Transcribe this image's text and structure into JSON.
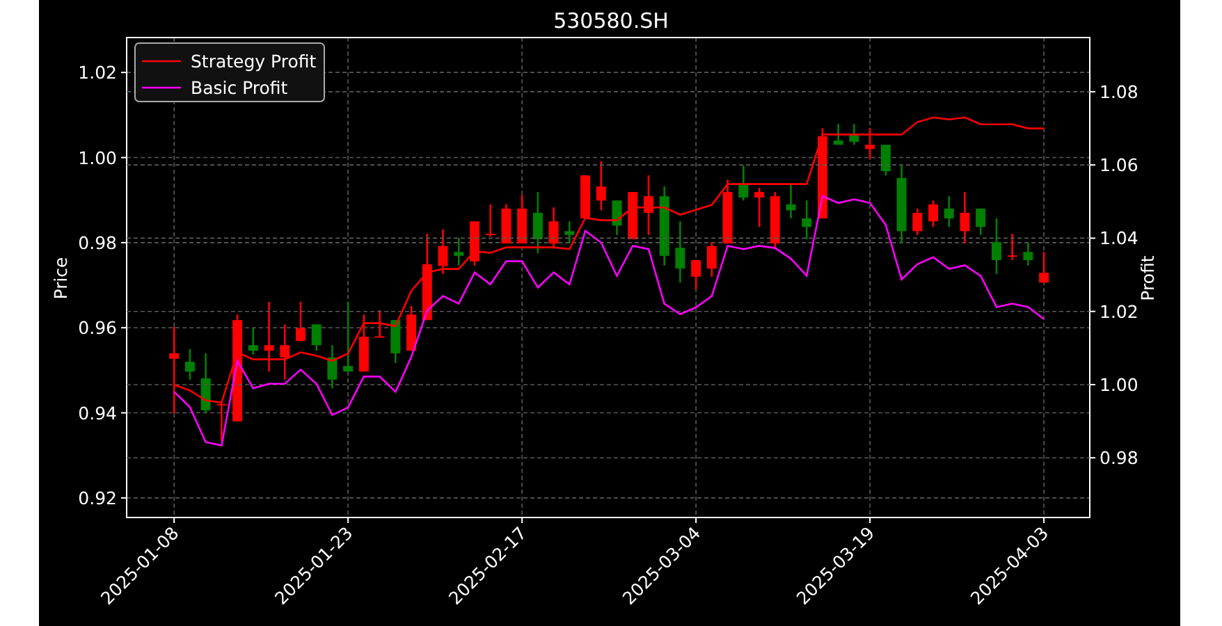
{
  "charts": [
    {
      "chart_data": {
        "type": "candlestick",
        "title": "530580.SH",
        "ylabel": "Price",
        "grid": true,
        "categories": [
          "2025-01-08",
          null,
          null,
          null,
          null,
          null,
          null,
          null,
          null,
          null,
          null,
          "2025-01-23",
          null,
          null,
          null,
          null,
          null,
          null,
          null,
          null,
          null,
          null,
          "2025-02-17",
          null,
          null,
          null,
          null,
          null,
          null,
          null,
          null,
          null,
          null,
          "2025-03-04",
          null,
          null,
          null,
          null,
          null,
          null,
          null,
          null,
          null,
          null,
          "2025-03-19",
          null,
          null,
          null,
          null,
          null,
          null,
          null,
          null,
          null,
          null,
          "2025-04-03"
        ],
        "ylim": [
          0.9154,
          1.0282
        ],
        "yticks": [
          {
            "value": 0.92,
            "label": "0.92"
          },
          {
            "value": 0.94,
            "label": "0.94"
          },
          {
            "value": 0.96,
            "label": "0.96"
          },
          {
            "value": 0.98,
            "label": "0.98"
          },
          {
            "value": 1.0,
            "label": "1.00"
          },
          {
            "value": 1.02,
            "label": "1.02"
          }
        ],
        "ohlc": [
          [
            0.9527,
            0.9602,
            0.9399,
            0.954
          ],
          [
            0.952,
            0.955,
            0.9478,
            0.9497
          ],
          [
            0.9481,
            0.954,
            0.9399,
            0.9406
          ],
          [
            0.9418,
            0.9422,
            0.9334,
            0.9421
          ],
          [
            0.938,
            0.9631,
            0.938,
            0.9618
          ],
          [
            0.9559,
            0.9599,
            0.9537,
            0.9546
          ],
          [
            0.9546,
            0.9661,
            0.9497,
            0.9559
          ],
          [
            0.953,
            0.9608,
            0.9478,
            0.9559
          ],
          [
            0.9569,
            0.9661,
            0.9569,
            0.9599
          ],
          [
            0.9608,
            0.9608,
            0.9546,
            0.9559
          ],
          [
            0.953,
            0.9559,
            0.9458,
            0.9478
          ],
          [
            0.951,
            0.9661,
            0.9497,
            0.9497
          ],
          [
            0.9497,
            0.9631,
            0.9497,
            0.9579
          ],
          [
            0.9578,
            0.9641,
            0.9578,
            0.958
          ],
          [
            0.9618,
            0.9618,
            0.9517,
            0.954
          ],
          [
            0.9546,
            0.9651,
            0.9546,
            0.9631
          ],
          [
            0.9618,
            0.9821,
            0.9618,
            0.9749
          ],
          [
            0.9745,
            0.9831,
            0.9726,
            0.9792
          ],
          [
            0.9778,
            0.9811,
            0.9746,
            0.9769
          ],
          [
            0.9756,
            0.985,
            0.9746,
            0.985
          ],
          [
            0.9819,
            0.989,
            0.9814,
            0.9821
          ],
          [
            0.9798,
            0.989,
            0.9798,
            0.988
          ],
          [
            0.9798,
            0.9912,
            0.9798,
            0.988
          ],
          [
            0.987,
            0.9919,
            0.9775,
            0.9808
          ],
          [
            0.9798,
            0.9883,
            0.9788,
            0.985
          ],
          [
            0.9827,
            0.985,
            0.9798,
            0.9818
          ],
          [
            0.9857,
            0.9958,
            0.9857,
            0.9958
          ],
          [
            0.9899,
            0.9991,
            0.9876,
            0.9932
          ],
          [
            0.9899,
            0.9899,
            0.9818,
            0.984
          ],
          [
            0.9808,
            0.9919,
            0.9808,
            0.9919
          ],
          [
            0.987,
            0.9958,
            0.9818,
            0.9909
          ],
          [
            0.9909,
            0.9932,
            0.9746,
            0.9769
          ],
          [
            0.9788,
            0.985,
            0.9706,
            0.9739
          ],
          [
            0.972,
            0.9759,
            0.969,
            0.9759
          ],
          [
            0.9739,
            0.9801,
            0.972,
            0.9792
          ],
          [
            0.9798,
            0.9948,
            0.9798,
            0.9919
          ],
          [
            0.9939,
            0.9981,
            0.9899,
            0.9906
          ],
          [
            0.9906,
            0.9929,
            0.9837,
            0.9919
          ],
          [
            0.9798,
            0.9919,
            0.9788,
            0.9909
          ],
          [
            0.989,
            0.9939,
            0.9857,
            0.9876
          ],
          [
            0.9857,
            0.9899,
            0.9808,
            0.9837
          ],
          [
            0.9857,
            1.0069,
            0.9857,
            1.005
          ],
          [
            1.004,
            1.0079,
            1.003,
            1.003
          ],
          [
            1.0053,
            1.0079,
            1.003,
            1.0037
          ],
          [
            1.002,
            1.0069,
            0.9997,
            1.003
          ],
          [
            1.003,
            1.003,
            0.9958,
            0.9968
          ],
          [
            0.9952,
            0.9981,
            0.9798,
            0.9827
          ],
          [
            0.9827,
            0.988,
            0.9818,
            0.987
          ],
          [
            0.985,
            0.9899,
            0.9837,
            0.989
          ],
          [
            0.988,
            0.9909,
            0.9837,
            0.9857
          ],
          [
            0.9827,
            0.9919,
            0.9798,
            0.987
          ],
          [
            0.988,
            0.988,
            0.9818,
            0.9837
          ],
          [
            0.9801,
            0.9857,
            0.9726,
            0.9759
          ],
          [
            0.9768,
            0.9821,
            0.9759,
            0.977
          ],
          [
            0.9778,
            0.9801,
            0.9746,
            0.9759
          ],
          [
            0.9706,
            0.9778,
            0.9706,
            0.9729
          ]
        ]
      }
    },
    {
      "chart_data": {
        "type": "line",
        "ylabel": "Profit",
        "grid": true,
        "legend": "upper left",
        "categories": [
          null,
          null,
          null,
          null,
          null,
          null,
          null,
          null,
          null,
          null,
          null,
          null,
          null,
          null,
          null,
          null,
          null,
          null,
          null,
          null,
          null,
          null,
          null,
          null,
          null,
          null,
          null,
          null,
          null,
          null,
          null,
          null,
          null,
          null,
          null,
          null,
          null,
          null,
          null,
          null,
          null,
          null,
          null,
          null,
          null,
          null,
          null,
          null,
          null,
          null,
          null,
          null,
          null,
          null,
          null,
          null
        ],
        "ylim": [
          0.9637,
          1.0948
        ],
        "yticks": [
          {
            "value": 0.98,
            "label": "0.98"
          },
          {
            "value": 1.0,
            "label": "1.00"
          },
          {
            "value": 1.02,
            "label": "1.02"
          },
          {
            "value": 1.04,
            "label": "1.04"
          },
          {
            "value": 1.06,
            "label": "1.06"
          },
          {
            "value": 1.08,
            "label": "1.08"
          }
        ],
        "series": [
          {
            "name": "Strategy Profit",
            "color": "#ff0000",
            "values": [
              0.9999,
              0.9984,
              0.9957,
              0.9951,
              1.0088,
              1.0069,
              1.0069,
              1.0069,
              1.0088,
              1.0079,
              1.0065,
              1.0085,
              1.0168,
              1.0168,
              1.016,
              1.0256,
              1.0306,
              1.0316,
              1.0316,
              1.0364,
              1.036,
              1.0375,
              1.0375,
              1.0375,
              1.0375,
              1.037,
              1.0455,
              1.0449,
              1.0449,
              1.0484,
              1.0484,
              1.0484,
              1.0464,
              1.0478,
              1.0491,
              1.0548,
              1.0548,
              1.0548,
              1.0548,
              1.0548,
              1.0548,
              1.0683,
              1.0683,
              1.0683,
              1.0683,
              1.0683,
              1.0683,
              1.0717,
              1.073,
              1.0724,
              1.073,
              1.0711,
              1.0711,
              1.0711,
              1.07,
              1.07
            ]
          },
          {
            "name": "Basic Profit",
            "color": "#ff00ff",
            "values": [
              0.998,
              0.9938,
              0.9843,
              0.9834,
              1.0065,
              0.999,
              1.0002,
              1.0002,
              1.0041,
              1.0002,
              0.9917,
              0.9938,
              1.0022,
              1.0022,
              0.998,
              1.0075,
              1.0202,
              1.0242,
              1.0221,
              1.0306,
              1.0274,
              1.0337,
              1.0337,
              1.0265,
              1.0306,
              1.0274,
              1.042,
              1.0388,
              1.0297,
              1.0379,
              1.037,
              1.0221,
              1.0192,
              1.0211,
              1.0242,
              1.0379,
              1.037,
              1.0379,
              1.0373,
              1.0344,
              1.0297,
              1.0515,
              1.0496,
              1.0506,
              1.0496,
              1.0436,
              1.0287,
              1.0329,
              1.0348,
              1.0316,
              1.0326,
              1.0297,
              1.0212,
              1.0221,
              1.0212,
              1.0179
            ]
          }
        ]
      }
    }
  ]
}
